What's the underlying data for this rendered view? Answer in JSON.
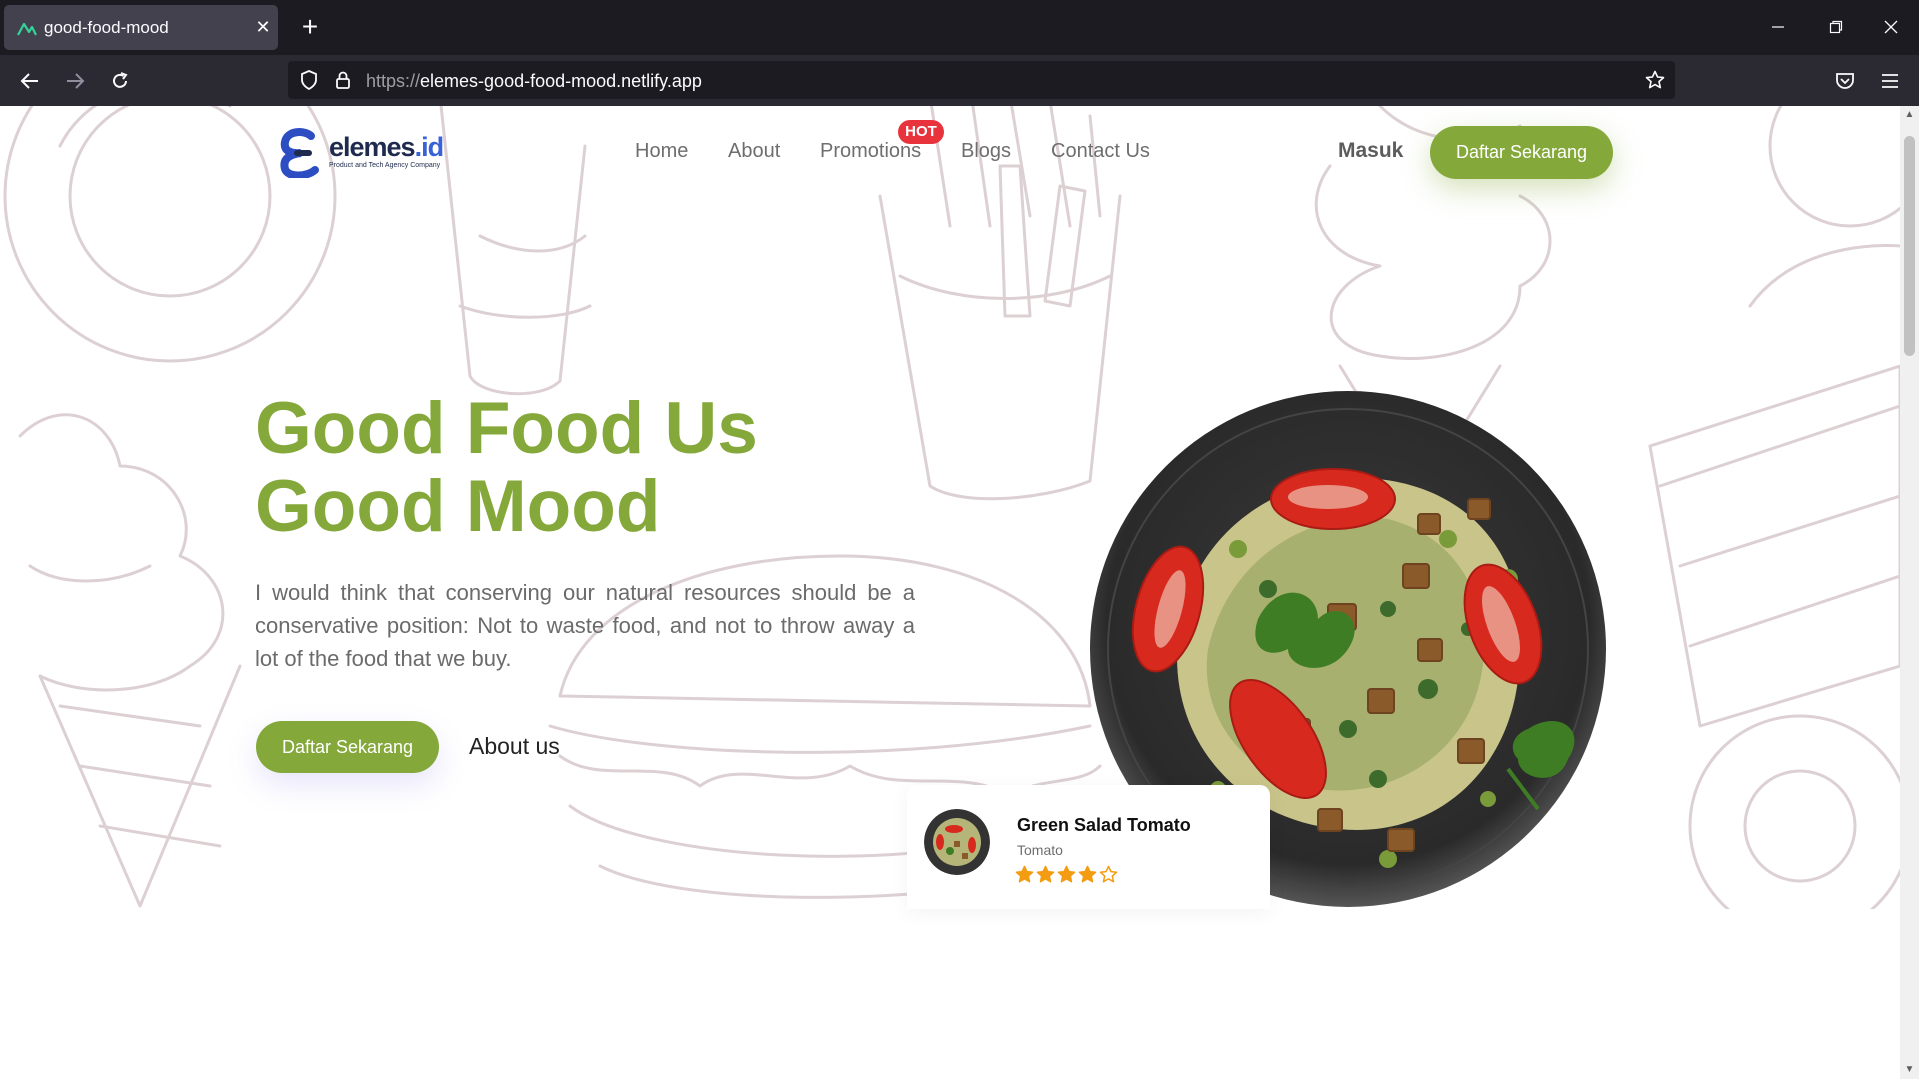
{
  "browser": {
    "tab_title": "good-food-mood",
    "url_scheme": "https://",
    "url_host": "elemes-good-food-mood.netlify.app"
  },
  "site": {
    "logo": {
      "name": "elemes",
      "tld": ".id",
      "tagline": "Product and Tech Agency Company"
    },
    "nav": [
      {
        "label": "Home"
      },
      {
        "label": "About"
      },
      {
        "label": "Promotions"
      },
      {
        "label": "Blogs"
      },
      {
        "label": "Contact Us"
      }
    ],
    "hot_badge": "HOT",
    "login_label": "Masuk",
    "signup_label": "Daftar Sekarang"
  },
  "hero": {
    "title_line1": "Good Food Us",
    "title_line2": "Good Mood",
    "description": "I would think that conserving our natural resources should be a conservative position: Not to waste food, and not to throw away a lot of the food that we buy.",
    "cta_label": "Daftar Sekarang",
    "about_label": "About us"
  },
  "food_card": {
    "name": "Green Salad Tomato",
    "subtitle": "Tomato",
    "rating": 4,
    "max_rating": 5
  },
  "colors": {
    "brand_green": "#85a83a",
    "hot_red": "#e8333c",
    "star_orange": "#f39c12"
  }
}
